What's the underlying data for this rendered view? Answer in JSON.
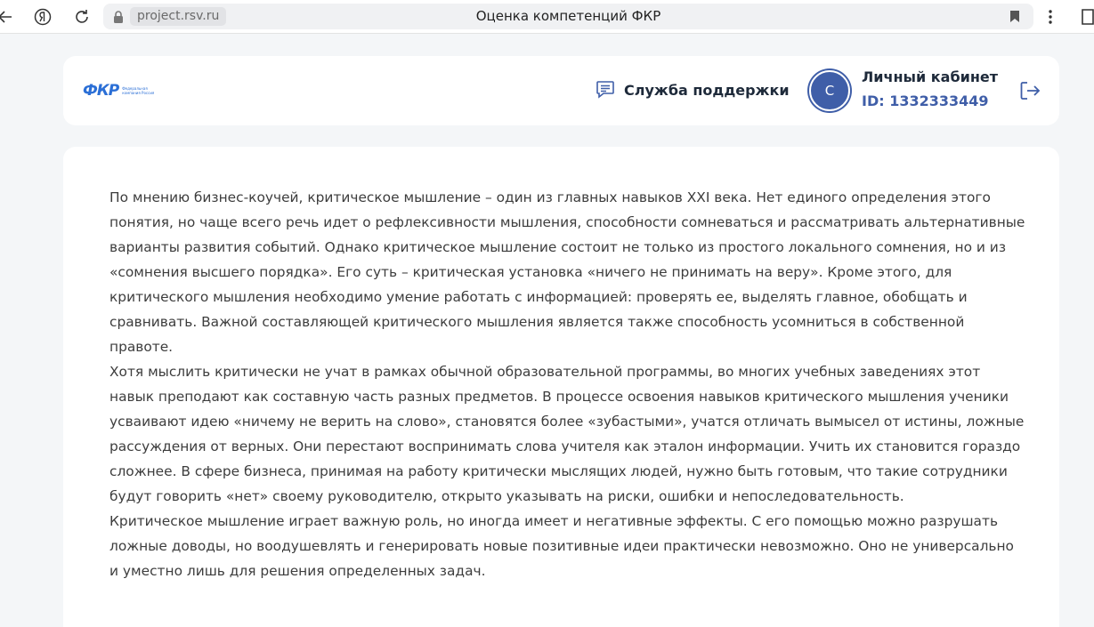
{
  "browser": {
    "domain": "project.rsv.ru",
    "page_title": "Оценка компетенций ФКР"
  },
  "header": {
    "logo": "ФКР",
    "logo_sub": "Федеральная компания Россия",
    "support_label": "Служба поддержки",
    "avatar_letter": "С",
    "cabinet_title": "Личный кабинет",
    "cabinet_id": "ID: 1332333449"
  },
  "content": {
    "paragraphs": [
      "По мнению бизнес-коучей, критическое мышление – один из главных навыков XXI века. Нет единого определения этого понятия, но чаще всего речь идет о рефлексивности мышления, способности сомневаться и рассматривать альтернативные варианты развития событий. Однако критическое мышление состоит не только из простого локального сомнения, но и из «сомнения высшего порядка». Его суть – критическая установка «ничего не принимать на веру». Кроме этого, для критического мышления необходимо умение работать с информацией: проверять ее, выделять главное, обобщать и сравнивать. Важной составляющей критического мышления является также способность усомниться в собственной правоте.",
      "Хотя мыслить критически не учат в рамках обычной образовательной программы, во многих учебных заведениях этот навык преподают как составную часть разных предметов. В процессе освоения навыков критического мышления ученики усваивают идею «ничему не верить на слово», становятся более «зубастыми», учатся отличать вымысел от истины, ложные рассуждения от верных. Они перестают воспринимать слова учителя как эталон информации. Учить их становится гораздо сложнее. В сфере бизнеса, принимая на работу критически мыслящих людей, нужно быть готовым, что такие сотрудники будут говорить «нет» своему руководителю, открыто указывать на риски, ошибки и непоследовательность.",
      "Критическое мышление играет важную роль, но иногда имеет и негативные эффекты. С его помощью можно разрушать ложные доводы, но воодушевлять и генерировать новые позитивные идеи практически невозможно. Оно не универсально и уместно лишь для решения определенных задач."
    ]
  },
  "colors": {
    "accent": "#3f5ea8",
    "logo_blue": "#2b6fd6",
    "page_bg": "#f4f6f8"
  }
}
